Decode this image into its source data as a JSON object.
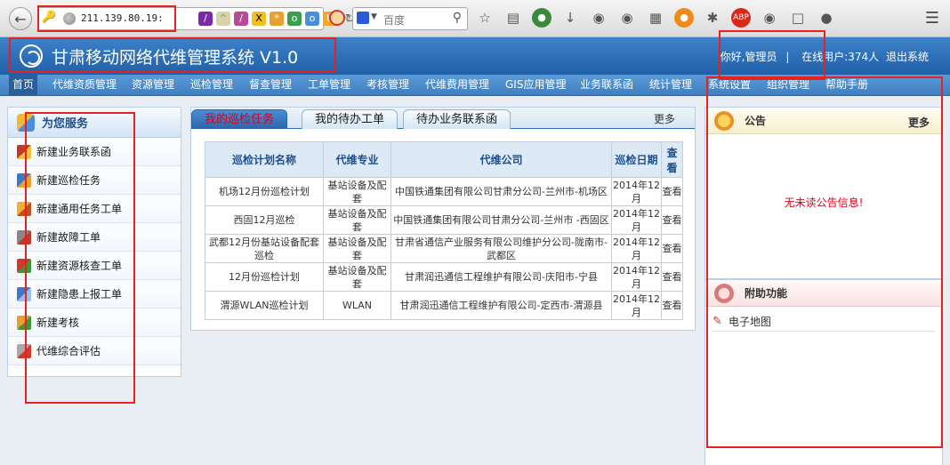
{
  "browser": {
    "url": "211.139.80.19:",
    "search_placeholder": "百度"
  },
  "header": {
    "title": "甘肃移动网络代维管理系统 V1.0",
    "greeting": "你好,管理员",
    "online_users": "在线用户:374人",
    "logout": "退出系统"
  },
  "nav": {
    "items": [
      "首页",
      "代维资质管理",
      "资源管理",
      "巡检管理",
      "督查管理",
      "工单管理",
      "考核管理",
      "代维费用管理",
      "GIS应用管理",
      "业务联系函",
      "统计管理",
      "系统设置",
      "组织管理",
      "帮助手册"
    ]
  },
  "left_panel": {
    "title": "为您服务",
    "items": [
      "新建业务联系函",
      "新建巡检任务",
      "新建通用任务工单",
      "新建故障工单",
      "新建资源核查工单",
      "新建隐患上报工单",
      "新建考核",
      "代维综合评估"
    ]
  },
  "tabs": {
    "items": [
      "我的巡检任务",
      "我的待办工单",
      "待办业务联系函"
    ],
    "more": "更多"
  },
  "task_table": {
    "headers": [
      "巡检计划名称",
      "代维专业",
      "代维公司",
      "巡检日期",
      "查看"
    ],
    "rows": [
      {
        "name": "机场12月份巡检计划",
        "specialty": "基站设备及配套",
        "company": "中国铁通集团有限公司甘肃分公司-兰州市-机场区",
        "date": "2014年12月",
        "view": "查看"
      },
      {
        "name": "西固12月巡检",
        "specialty": "基站设备及配套",
        "company": "中国铁通集团有限公司甘肃分公司-兰州市 -西固区",
        "date": "2014年12月",
        "view": "查看"
      },
      {
        "name": "武都12月份基站设备配套巡检",
        "specialty": "基站设备及配套",
        "company": "甘肃省通信产业服务有限公司维护分公司-陇南市-武都区",
        "date": "2014年12月",
        "view": "查看"
      },
      {
        "name": "12月份巡检计划",
        "specialty": "基站设备及配套",
        "company": "甘肃润迅通信工程维护有限公司-庆阳市-宁县",
        "date": "2014年12月",
        "view": "查看"
      },
      {
        "name": "渭源WLAN巡检计划",
        "specialty": "WLAN",
        "company": "甘肃润迅通信工程维护有限公司-定西市-渭源县",
        "date": "2014年12月",
        "view": "查看"
      }
    ]
  },
  "notice": {
    "title": "公告",
    "more": "更多",
    "empty_text": "无未读公告信息!"
  },
  "addons": {
    "title": "附助功能",
    "items": [
      "电子地图"
    ]
  },
  "colors": {
    "header_blue": "#2f70b8",
    "nav_blue": "#4a8ccc",
    "annotation_red": "#e8201e",
    "notice_red": "#e0001a"
  }
}
